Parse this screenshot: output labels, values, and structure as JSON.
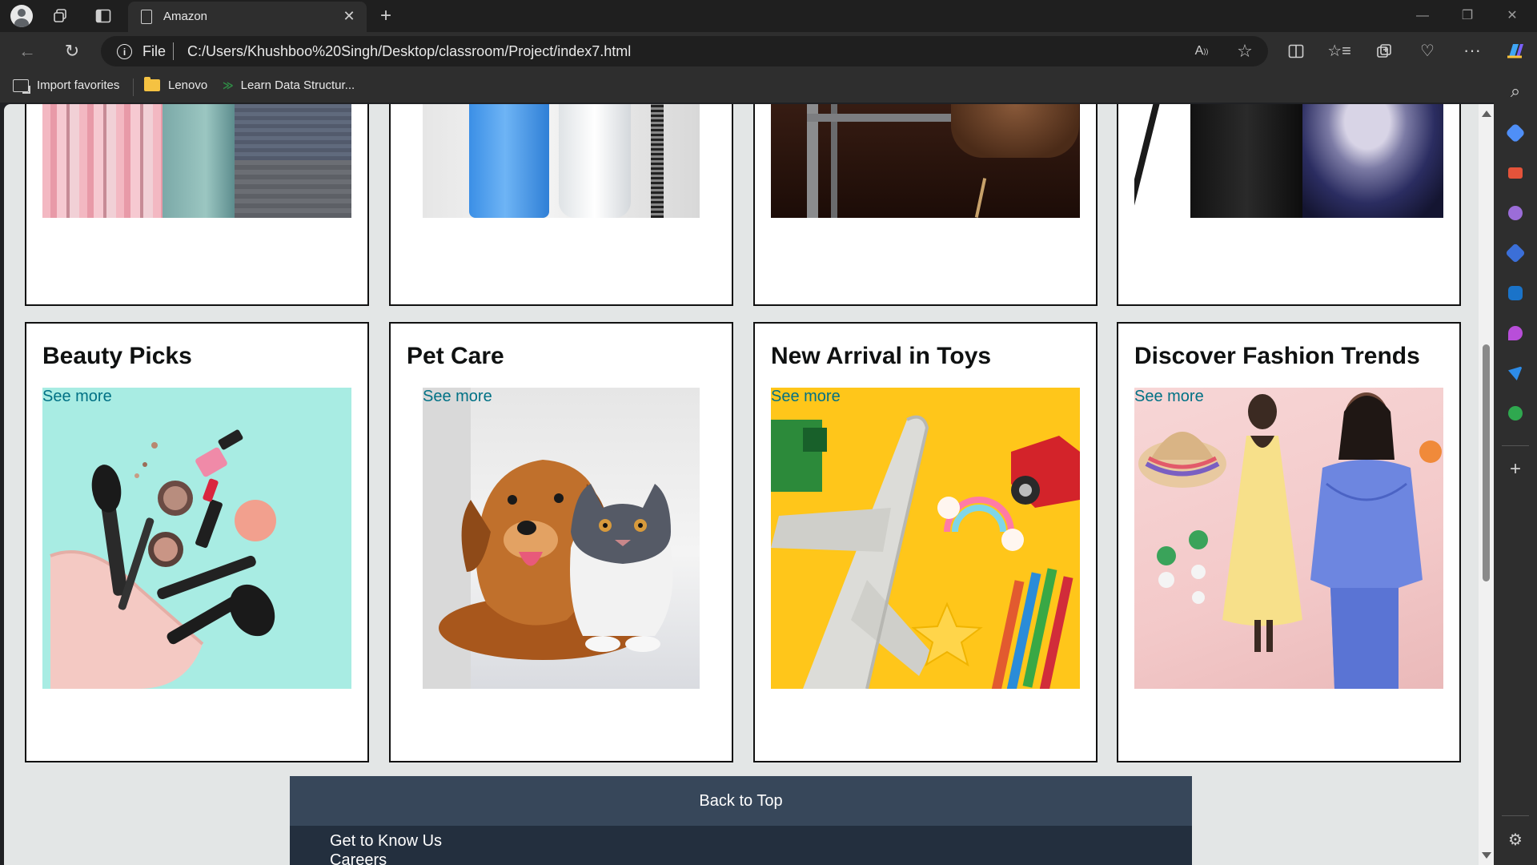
{
  "browser": {
    "tab_title": "Amazon",
    "address_scheme": "File",
    "address_url": "C:/Users/Khushboo%20Singh/Desktop/classroom/Project/index7.html",
    "bookmarks": [
      {
        "label": "Import favorites",
        "icon": "import-favorites-icon"
      },
      {
        "label": "Lenovo",
        "icon": "folder-icon"
      },
      {
        "label": "Learn Data Structur...",
        "icon": "gg-logo-icon"
      }
    ]
  },
  "page": {
    "top_cards": [
      {
        "image": "pastel-fabrics-image"
      },
      {
        "image": "bath-accessories-image"
      },
      {
        "image": "ladder-and-chair-image"
      },
      {
        "image": "samsung-phones-image"
      }
    ],
    "cards": [
      {
        "title": "Beauty Picks",
        "link": "See more",
        "image": "makeup-image"
      },
      {
        "title": "Pet Care",
        "link": "See more",
        "image": "dog-and-cat-image"
      },
      {
        "title": "New Arrival in Toys",
        "link": "See more",
        "image": "toys-image"
      },
      {
        "title": "Discover Fashion Trends",
        "link": "See more",
        "image": "fashion-image"
      }
    ],
    "back_to_top": "Back to Top",
    "footer": {
      "heading": "Get to Know Us",
      "links": [
        "Careers"
      ]
    }
  }
}
